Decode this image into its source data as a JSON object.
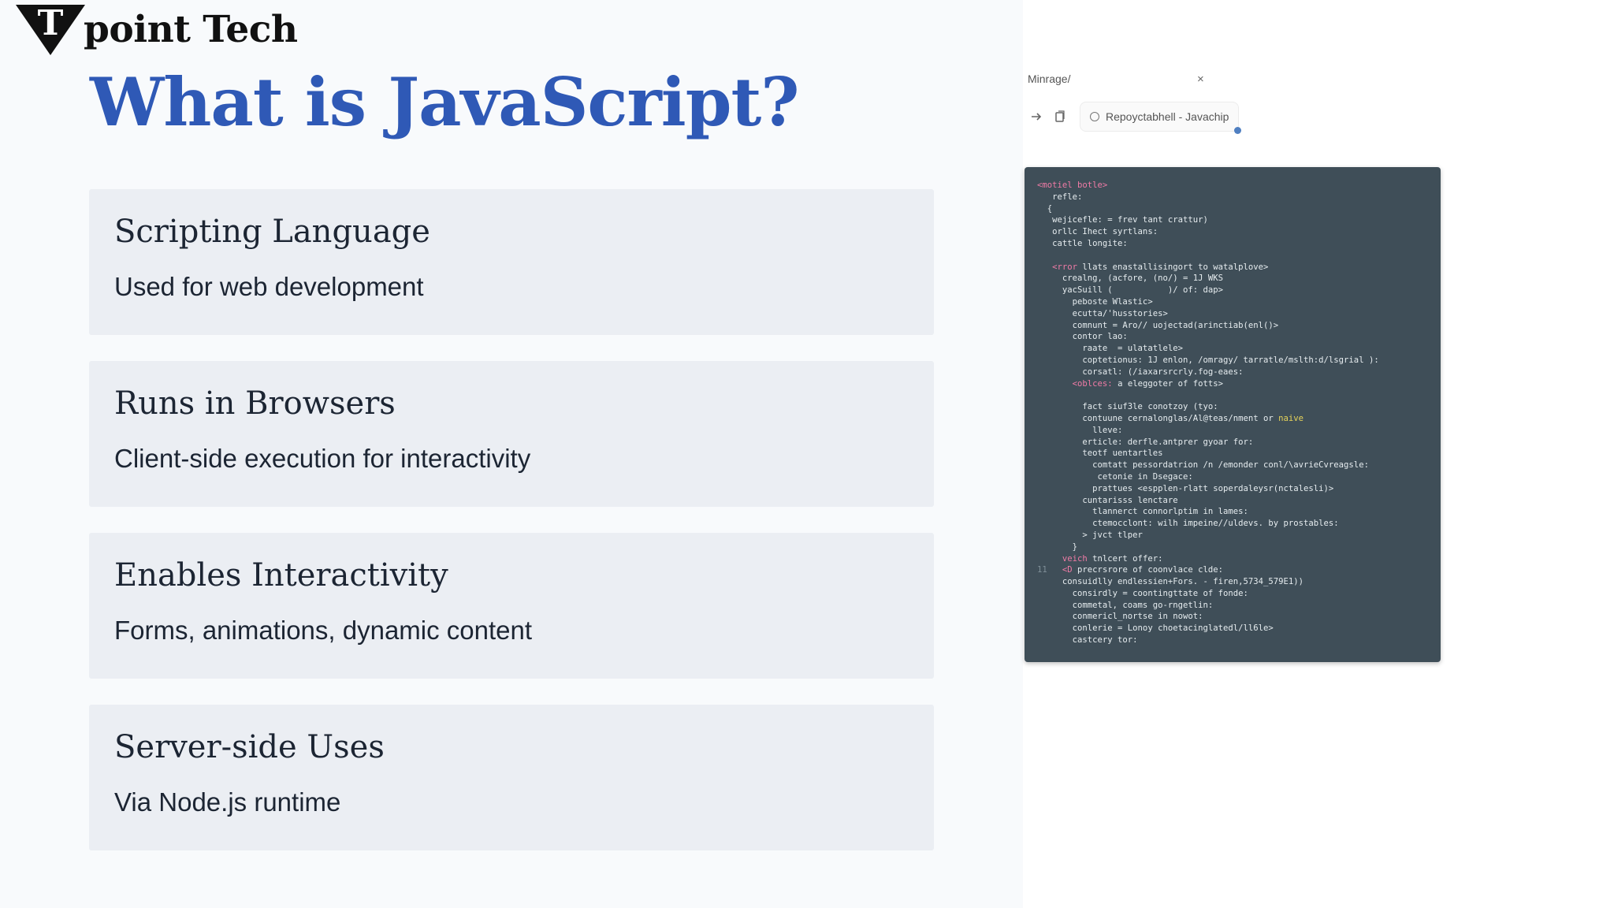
{
  "logo": {
    "letter": "T",
    "text": "point Tech"
  },
  "slide": {
    "title": "What is JavaScript?"
  },
  "cards": [
    {
      "title": "Scripting Language",
      "desc": "Used for web development"
    },
    {
      "title": "Runs in Browsers",
      "desc": "Client-side execution for interactivity"
    },
    {
      "title": "Enables Interactivity",
      "desc": "Forms, animations, dynamic content"
    },
    {
      "title": "Server-side Uses",
      "desc": "Via Node.js runtime"
    }
  ],
  "browser": {
    "tab_label": "Minrage/",
    "tab_close": "×",
    "address": "Repoyctabhell - Javachip"
  },
  "code": {
    "l01": "<motiel botle>",
    "l02": "   refle:",
    "l03": "  {",
    "l04": "   wejicefle: = frev tant crattur)",
    "l05": "   orllc Ihect syrtlans:",
    "l06": "   cattle longite:",
    "l07": "<rror",
    "l07b": " llats enastallisingort to watalplove>",
    "l08": "     crealng, (acfore, (no/) = 1J WKS",
    "l09": "     yacSuill (           )/ of: dap>",
    "l10": "       peboste Wlastic>",
    "l11": "       ecutta/'husstories>",
    "l12": "       comnunt = Aro// uojectad(arinctiab(enl()>",
    "l13": "       contor lao:",
    "l14": "         raate  = ulatatlele>",
    "l15": "         coptetionus: 1J enlon, /omragy/ tarratle/mslth:d/lsgrial ):",
    "l16": "         corsatl: (/iaxarsrcrly.fog-eaes:",
    "l17": "<oblces:",
    "l17b": " a eleggoter of fotts>",
    "l18": "         fact siuf3le conotzoy (tyo:",
    "l19": "         contuune cernalonglas/Al@teas/nment or ",
    "l19b": "naive",
    "l20": "           lleve:",
    "l21": "         erticle: derfle.antprer gyoar for:",
    "l22": "         teotf uentartles",
    "l23": "           comtatt pessordatrion /n /emonder conl/\\avrieCvreagsle:",
    "l24": "            cetonie in Dsegace:",
    "l25": "           prattues <espplen-rlatt soperdaleysr(nctalesli)>",
    "l26": "         cuntarisss lenctare",
    "l27": "           tlannerct connorlptim in lames:",
    "l28": "           ctemocclont: wilh impeine//uldevs. by prostables:",
    "l29": "         > jvct tlper",
    "l30": "       }",
    "l31": "veich",
    "l31b": " tnlcert offer:",
    "l32": "<D",
    "l32b": " precrsrore of coonvlace clde:",
    "l33": "     consuidlly endlessien+Fors. - firen,5734_579E1))",
    "l34": "       consirdly = coontingttate of fonde:",
    "l35": "       commetal, coams go-rngetlin:",
    "l36": "       conmericl_nortse in nowot:",
    "l37": "       conlerie = Lonoy choetacinglatedl/ll6le>",
    "l38": "       castcery tor:"
  }
}
